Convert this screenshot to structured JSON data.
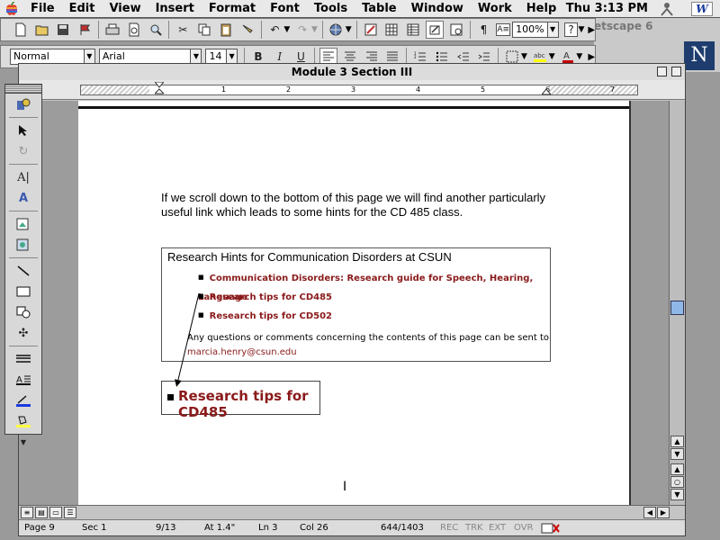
{
  "menubar": {
    "items": [
      "File",
      "Edit",
      "View",
      "Insert",
      "Format",
      "Font",
      "Tools",
      "Table",
      "Window",
      "Work",
      "Help"
    ],
    "clock": "Thu 3:13 PM",
    "app_icon": "W"
  },
  "background_window": {
    "title": "etscape 6",
    "logo": "N"
  },
  "toolbar_formatting": {
    "style": "Normal",
    "font": "Arial",
    "size": "14",
    "bold": "B",
    "italic": "I",
    "underline": "U",
    "zoom": "100%"
  },
  "document": {
    "window_title": "Module 3 Section III",
    "ruler_numbers": [
      "1",
      "2",
      "3",
      "4",
      "5",
      "6",
      "7"
    ],
    "intro_text": "If we scroll down to the bottom of this page we will find another particularly useful link which leads to some hints for the CD 485 class.",
    "hints_box": {
      "title": "Research Hints for Communication Disorders at CSUN",
      "links": [
        "Communication Disorders: Research guide for Speech, Hearing, Language",
        "Research tips for CD485",
        "Research tips for CD502"
      ],
      "contact_text": "Any questions or comments concerning the contents of this page can be sent to",
      "contact_email": "marcia.henry@csun.edu"
    },
    "zoomed_link": "Research tips for CD485"
  },
  "statusbar": {
    "page": "Page 9",
    "sec": "Sec 1",
    "pages": "9/13",
    "at": "At 1.4\"",
    "ln": "Ln 3",
    "col": "Col 26",
    "words": "644/1403",
    "rec": "REC",
    "trk": "TRK",
    "ext": "EXT",
    "ovr": "OVR"
  },
  "colors": {
    "link": "#8a1a1a",
    "scroll_thumb": "#8fb8e8"
  }
}
